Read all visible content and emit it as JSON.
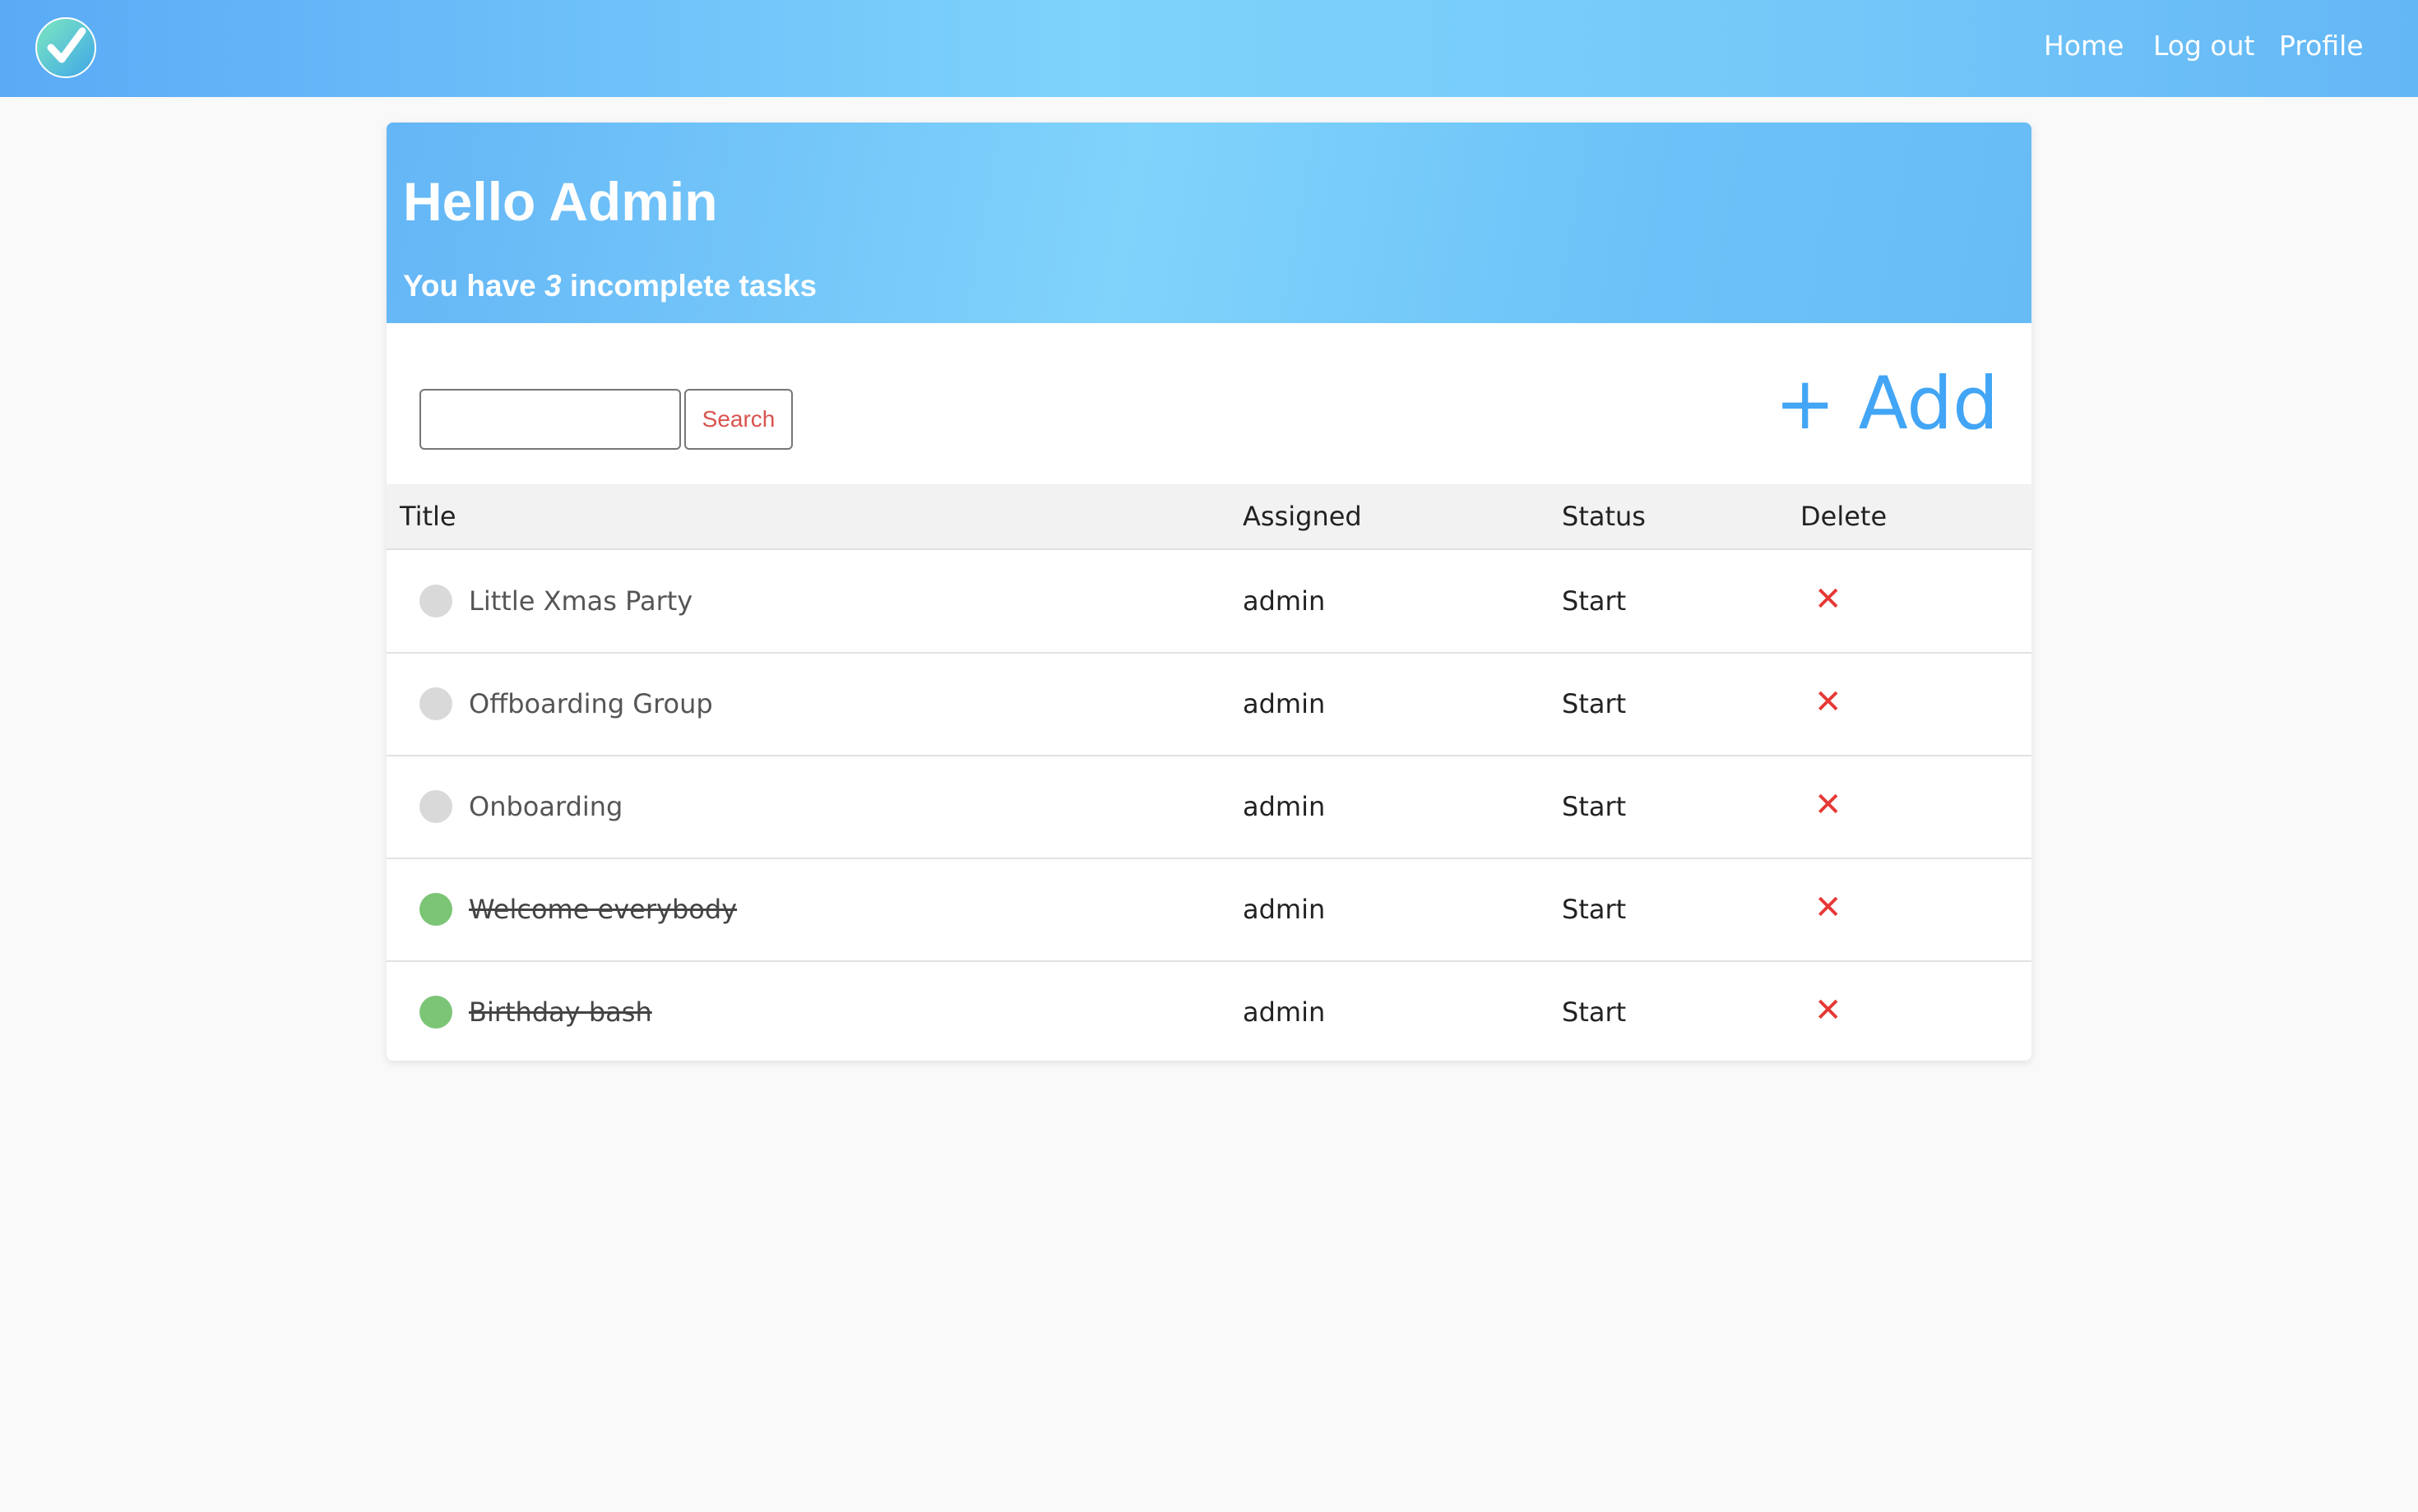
{
  "nav": {
    "home": "Home",
    "logout": "Log out",
    "profile": "Profile"
  },
  "hero": {
    "greeting": "Hello Admin",
    "sub_prefix": "You have",
    "incomplete_count": "3",
    "sub_suffix": "incomplete tasks"
  },
  "search": {
    "placeholder": "",
    "value": "",
    "button_label": "Search"
  },
  "add_label": "+ Add",
  "table": {
    "headers": {
      "title": "Title",
      "assigned": "Assigned",
      "status": "Status",
      "delete": "Delete"
    },
    "rows": [
      {
        "title": "Little Xmas Party",
        "assigned": "admin",
        "status": "Start",
        "completed": false,
        "delete_glyph": "✕"
      },
      {
        "title": "Offboarding Group",
        "assigned": "admin",
        "status": "Start",
        "completed": false,
        "delete_glyph": "✕"
      },
      {
        "title": "Onboarding",
        "assigned": "admin",
        "status": "Start",
        "completed": false,
        "delete_glyph": "✕"
      },
      {
        "title": "Welcome everybody",
        "assigned": "admin",
        "status": "Start",
        "completed": true,
        "delete_glyph": "✕"
      },
      {
        "title": "Birthday bash",
        "assigned": "admin",
        "status": "Start",
        "completed": true,
        "delete_glyph": "✕"
      }
    ]
  },
  "colors": {
    "accent": "#42a5f5",
    "delete": "#e53935",
    "done_dot": "#7cc576",
    "pending_dot": "#d9d9d9"
  },
  "icons": {
    "logo": "checkmark-logo-icon",
    "delete": "close-icon",
    "status_dot": "circle-toggle-icon"
  }
}
